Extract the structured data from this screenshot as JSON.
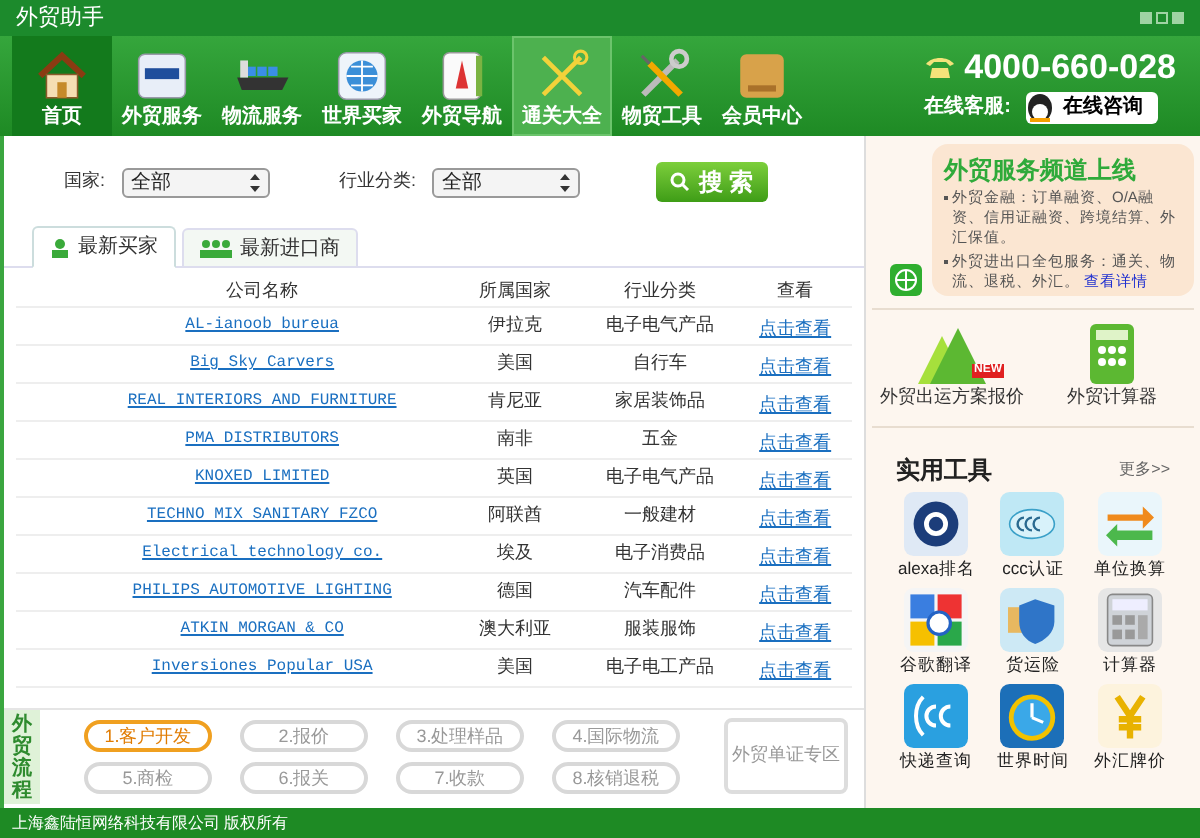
{
  "window": {
    "title": "外贸助手"
  },
  "nav": [
    {
      "label": "首页",
      "selected": true,
      "highlighted": false
    },
    {
      "label": "外贸服务",
      "selected": false,
      "highlighted": false
    },
    {
      "label": "物流服务",
      "selected": false,
      "highlighted": false
    },
    {
      "label": "世界买家",
      "selected": false,
      "highlighted": false
    },
    {
      "label": "外贸导航",
      "selected": false,
      "highlighted": false
    },
    {
      "label": "通关大全",
      "selected": false,
      "highlighted": true
    },
    {
      "label": "物贸工具",
      "selected": false,
      "highlighted": false
    },
    {
      "label": "会员中心",
      "selected": false,
      "highlighted": false
    }
  ],
  "contact": {
    "phone": "4000-660-028",
    "service_label": "在线客服:",
    "service_button": "在线咨询"
  },
  "filters": [
    {
      "label": "国家:",
      "value": "全部"
    },
    {
      "label": "行业分类:",
      "value": "全部"
    }
  ],
  "search_button": "搜 索",
  "tabs": [
    {
      "label": "最新买家",
      "selected": true
    },
    {
      "label": "最新进口商",
      "selected": false
    }
  ],
  "table": {
    "columns": [
      "公司名称",
      "所属国家",
      "行业分类",
      "查看"
    ],
    "rows": [
      [
        "AL-ianoob bureua",
        "伊拉克",
        "电子电气产品",
        "点击查看"
      ],
      [
        "Big Sky Carvers",
        "美国",
        "自行车",
        "点击查看"
      ],
      [
        "REAL INTERIORS AND FURNITURE",
        "肯尼亚",
        "家居装饰品",
        "点击查看"
      ],
      [
        "PMA DISTRIBUTORS",
        "南非",
        "五金",
        "点击查看"
      ],
      [
        "KNOXED LIMITED",
        "英国",
        "电子电气产品",
        "点击查看"
      ],
      [
        "TECHNO MIX SANITARY FZCO",
        "阿联酋",
        "一般建材",
        "点击查看"
      ],
      [
        "Electrical technology co.",
        "埃及",
        "电子消费品",
        "点击查看"
      ],
      [
        "PHILIPS AUTOMOTIVE LIGHTING",
        "德国",
        "汽车配件",
        "点击查看"
      ],
      [
        "ATKIN MORGAN & CO",
        "澳大利亚",
        "服装服饰",
        "点击查看"
      ],
      [
        "Inversiones Popular USA",
        "美国",
        "电子电工产品",
        "点击查看"
      ]
    ]
  },
  "process": {
    "title": "外贸流程",
    "steps": [
      {
        "label": "1.客户开发",
        "selected": true
      },
      {
        "label": "2.报价",
        "selected": false
      },
      {
        "label": "3.处理样品",
        "selected": false
      },
      {
        "label": "4.国际物流",
        "selected": false
      },
      {
        "label": "5.商检",
        "selected": false
      },
      {
        "label": "6.报关",
        "selected": false
      },
      {
        "label": "7.收款",
        "selected": false
      },
      {
        "label": "8.核销退税",
        "selected": false
      }
    ],
    "zone": "外贸单证专区"
  },
  "banner": {
    "title": "外贸服务频道上线",
    "bullets": [
      "外贸金融：订单融资、O/A融资、信用证融资、跨境结算、外汇保值。",
      "外贸进出口全包服务：通关、物流、退税、外汇。"
    ],
    "link": "查看详情"
  },
  "features": [
    {
      "label": "外贸出运方案报价",
      "badge": "NEW"
    },
    {
      "label": "外贸计算器"
    }
  ],
  "tools": {
    "title": "实用工具",
    "more": "更多>>",
    "items": [
      "alexa排名",
      "ccc认证",
      "单位换算",
      "谷歌翻译",
      "货运险",
      "计算器",
      "快递查询",
      "世界时间",
      "外汇牌价"
    ]
  },
  "footer": "上海鑫陆恒网络科技有限公司 版权所有"
}
